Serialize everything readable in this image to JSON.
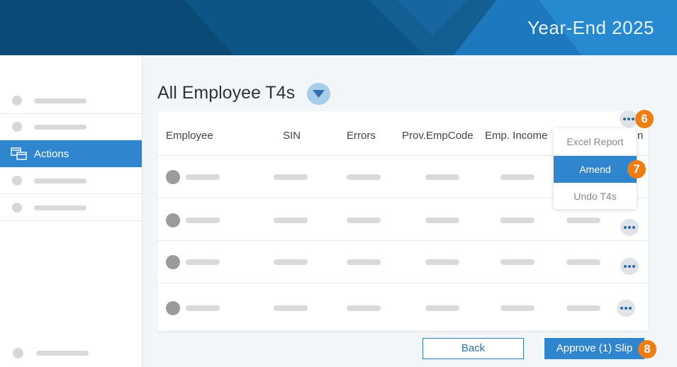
{
  "header": {
    "title": "Year-End 2025"
  },
  "sidebar": {
    "active_item": {
      "label": "Actions"
    }
  },
  "page": {
    "title": "All Employee T4s"
  },
  "table": {
    "columns": [
      "Employee",
      "SIN",
      "Errors",
      "Prov.EmpCode",
      "Emp. Income",
      "n"
    ]
  },
  "row_menu": {
    "items": [
      "Excel Report",
      "Amend",
      "Undo T4s"
    ],
    "selected": "Amend"
  },
  "steps": {
    "menu_trigger": "6",
    "amend": "7",
    "approve": "8"
  },
  "footer": {
    "back_label": "Back",
    "approve_label": "Approve (1) Slip"
  },
  "colors": {
    "header": "#0a4a76",
    "accent": "#2f86cf",
    "badge": "#f07d14"
  },
  "icons": {
    "sidebar_active": "copy-windows-icon",
    "title_dropdown": "caret-down-icon",
    "row_more": "more-horizontal-icon"
  }
}
